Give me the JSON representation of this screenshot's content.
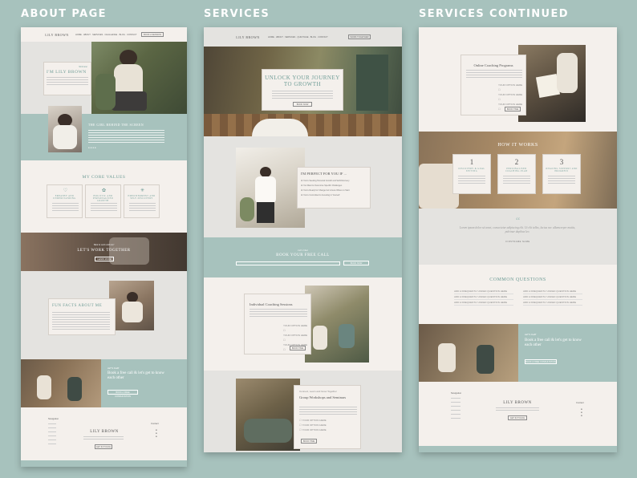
{
  "titles": {
    "about": "ABOUT PAGE",
    "services": "SERVICES",
    "continued": "SERVICES CONTINUED"
  },
  "about": {
    "logo": "LILY BROWN",
    "nav": [
      "HOME",
      "ABOUT",
      "SERVICES",
      "CHALLENGE",
      "BLOG",
      "CONTACT"
    ],
    "nav_button": "BOOK A SESSION",
    "welcome": "Welcome",
    "hero_title": "I'M LILY BROWN",
    "story_title": "THE GIRL BEHIND THE SCREEN",
    "values_title": "MY CORE VALUES",
    "values": [
      "EMPATHY AND UNDERSTANDING",
      "HOLISTIC AND PERSONALISED GROWTH",
      "EMPOWERMENT AND SELF-DISCOVERY"
    ],
    "work_small": "Want to work with me?",
    "work_title": "LET'S WORK TOGETHER",
    "work_button": "LEARN MORE",
    "facts_title": "FUN FACTS ABOUT ME",
    "cta_small": "LET'S CHAT",
    "cta_title": "Book a free call & let's get to know each other",
    "cta_button": "BOOK A FREE CONSULTATION",
    "footer_logo": "LILY BROWN",
    "footer_nav": "Navigation",
    "footer_contact": "Contact",
    "footer_button": "GET IN TOUCH"
  },
  "services": {
    "logo": "LILY BROWN",
    "nav": [
      "HOME",
      "ABOUT",
      "SERVICES",
      "QUIZ PAGE",
      "BLOG",
      "CONTACT"
    ],
    "nav_button": "WORK TOGETHER",
    "hero_title": "UNLOCK YOUR JOURNEY TO GROWTH",
    "hero_button": "BOOK NOW",
    "perfect_title": "I'M PERFECT FOR YOU IF ...",
    "perfect_items": [
      "You're Seeking Personal Growth and Self-Discovery",
      "You Want to Overcome Specific Challenges",
      "You're Ready for Change but Unsure Where to Start",
      "You're Committed to Investing in Yourself"
    ],
    "call_small": "Let's Chat",
    "call_title": "BOOK YOUR FREE CALL",
    "call_button": "BOOK NOW",
    "individual_title": "Individual Coaching Sessions",
    "group_small": "Connect, Learn and Grow Together",
    "group_title": "Group Workshops and Seminars",
    "option_button": "BOOK TIME",
    "options": [
      "YOUR OPTION HERE",
      "YOUR OPTION HERE",
      "YOUR OPTION HERE"
    ]
  },
  "continued": {
    "online_title": "Online Coaching Programs",
    "online_options": [
      "YOUR OPTION HERE",
      "YOUR OPTION HERE",
      "YOUR OPTION HERE"
    ],
    "online_button": "BOOK TIME",
    "how_title": "HOW IT WORKS",
    "steps": [
      {
        "num": "1",
        "label": "DISCOVERY & GOAL SETTING"
      },
      {
        "num": "2",
        "label": "PERSONALISED COACHING PLAN"
      },
      {
        "num": "3",
        "label": "ONGOING SUPPORT AND PROGRESS"
      }
    ],
    "quote": "Lorem ipsum dolor sit amet, consectetur adipiscing elit. Ut elit tellus, luctus nec ullamcorper mattis, pulvinar dapibus leo.",
    "quote_author": "FIRSTNAME NAME",
    "faq_title": "COMMON QUESTIONS",
    "faq_item": "ADD A FREQUENTLY ASKED QUESTION HERE",
    "cta_small": "LET'S CHAT",
    "cta_title": "Book a free call & let's get to know each other",
    "cta_button": "BOOK A FREE CONSULTATION",
    "footer_logo": "LILY BROWN",
    "footer_nav": "Navigation",
    "footer_contact": "Contact",
    "footer_button": "GET IN TOUCH"
  },
  "colors": {
    "teal": "#a7c2bd",
    "cream": "#f4f0ec",
    "accent": "#6e9c96"
  }
}
